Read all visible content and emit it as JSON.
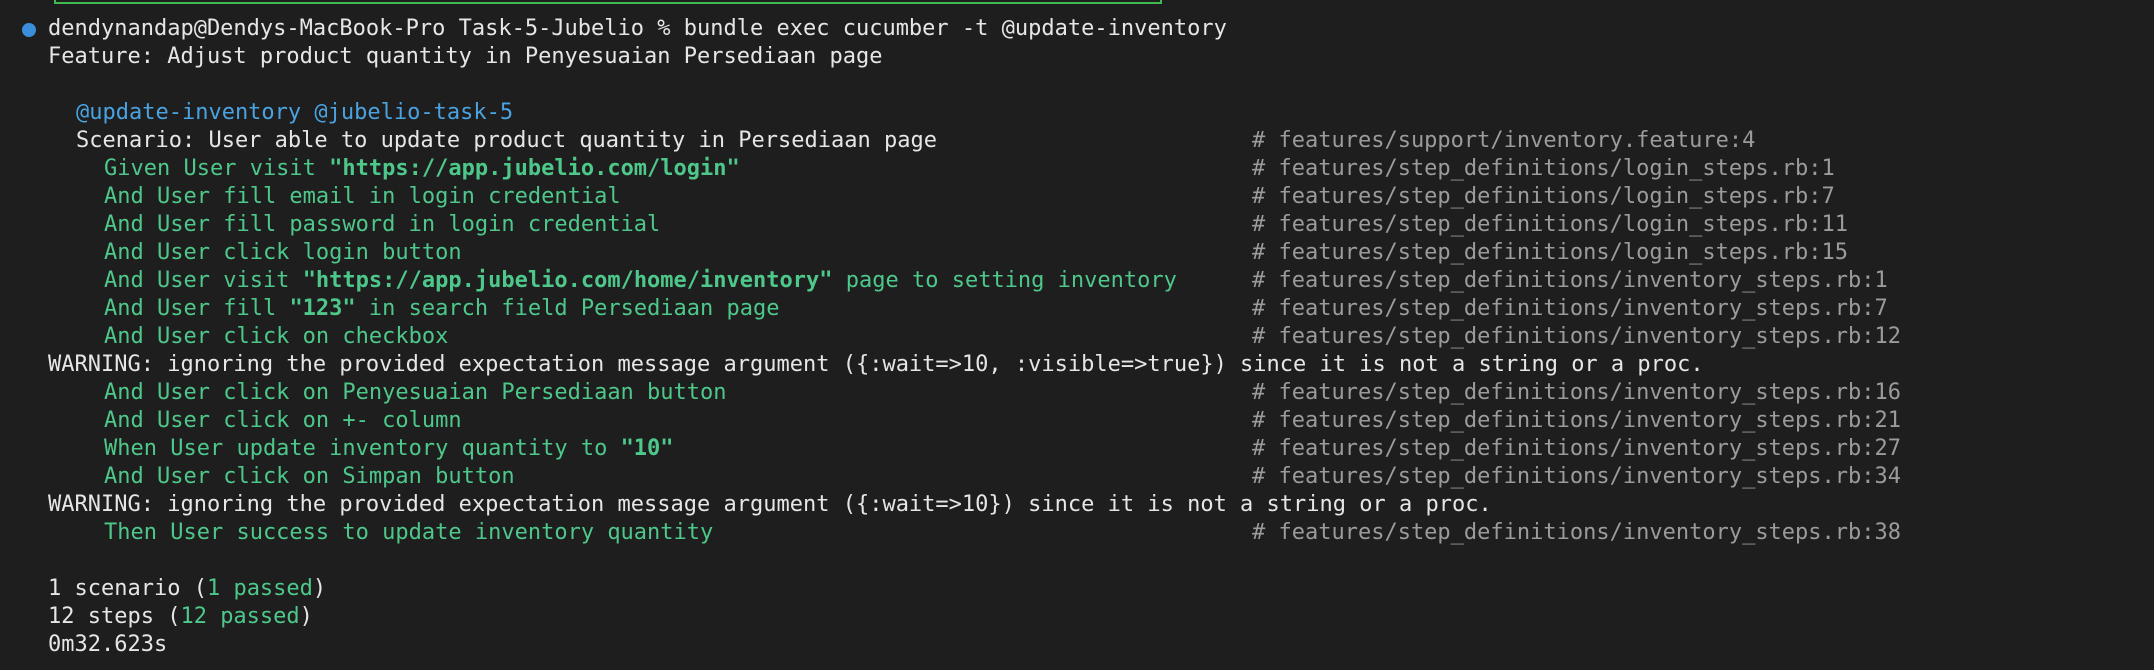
{
  "terminal": {
    "prompt": "dendynandap@Dendys-MacBook-Pro Task-5-Jubelio % bundle exec cucumber -t @update-inventory",
    "feature": "Feature: Adjust product quantity in Penyesuaian Persediaan page",
    "tags": "@update-inventory @jubelio-task-5",
    "scenario": {
      "text": "Scenario: User able to update product quantity in Persediaan page",
      "comment": "# features/support/inventory.feature:4"
    },
    "steps": [
      {
        "pre": "Given User visit ",
        "bold": "\"https://app.jubelio.com/login\"",
        "post": "",
        "comment": "# features/step_definitions/login_steps.rb:1"
      },
      {
        "pre": "And User fill email in login credential",
        "bold": "",
        "post": "",
        "comment": "# features/step_definitions/login_steps.rb:7"
      },
      {
        "pre": "And User fill password in login credential",
        "bold": "",
        "post": "",
        "comment": "# features/step_definitions/login_steps.rb:11"
      },
      {
        "pre": "And User click login button",
        "bold": "",
        "post": "",
        "comment": "# features/step_definitions/login_steps.rb:15"
      },
      {
        "pre": "And User visit ",
        "bold": "\"https://app.jubelio.com/home/inventory\"",
        "post": " page to setting inventory",
        "comment": "# features/step_definitions/inventory_steps.rb:1"
      },
      {
        "pre": "And User fill ",
        "bold": "\"123\"",
        "post": " in search field Persediaan page",
        "comment": "# features/step_definitions/inventory_steps.rb:7"
      },
      {
        "pre": "And User click on checkbox",
        "bold": "",
        "post": "",
        "comment": "# features/step_definitions/inventory_steps.rb:12"
      },
      {
        "pre": "And User click on Penyesuaian Persediaan button",
        "bold": "",
        "post": "",
        "comment": "# features/step_definitions/inventory_steps.rb:16"
      },
      {
        "pre": "And User click on +- column",
        "bold": "",
        "post": "",
        "comment": "# features/step_definitions/inventory_steps.rb:21"
      },
      {
        "pre": "When User update inventory quantity to ",
        "bold": "\"10\"",
        "post": "",
        "comment": "# features/step_definitions/inventory_steps.rb:27"
      },
      {
        "pre": "And User click on Simpan button",
        "bold": "",
        "post": "",
        "comment": "# features/step_definitions/inventory_steps.rb:34"
      },
      {
        "pre": "Then User success to update inventory quantity",
        "bold": "",
        "post": "",
        "comment": "# features/step_definitions/inventory_steps.rb:38"
      }
    ],
    "warnings": [
      "WARNING: ignoring the provided expectation message argument ({:wait=>10, :visible=>true}) since it is not a string or a proc.",
      "WARNING: ignoring the provided expectation message argument ({:wait=>10}) since it is not a string or a proc."
    ],
    "summary": {
      "scenario_count": "1 scenario (",
      "scenario_passed": "1 passed",
      "scenario_close": ")",
      "steps_count": "12 steps (",
      "steps_passed": "12 passed",
      "steps_close": ")",
      "duration": "0m32.623s"
    }
  },
  "colors": {
    "background": "#1e1e1e",
    "text": "#e6e6e6",
    "tag": "#4aa3e0",
    "step": "#4ec88a",
    "comment": "#9b9b9b",
    "prompt_dot": "#3b8edb"
  }
}
